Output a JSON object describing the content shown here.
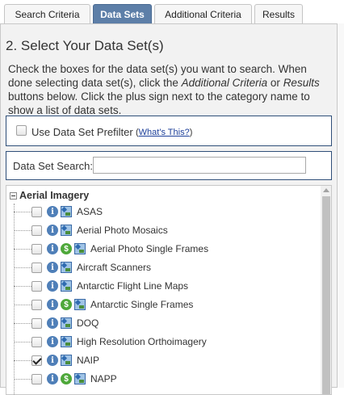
{
  "tabs": [
    {
      "label": "Search Criteria",
      "active": false
    },
    {
      "label": "Data Sets",
      "active": true
    },
    {
      "label": "Additional Criteria",
      "active": false
    },
    {
      "label": "Results",
      "active": false
    }
  ],
  "section": {
    "title": "2. Select Your Data Set(s)",
    "intro_1": "Check the boxes for the data set(s) you want to search. When done selecting data set(s), click the ",
    "intro_em1": "Additional Criteria",
    "intro_2": " or ",
    "intro_em2": "Results",
    "intro_3": " buttons below. Click the plus sign next to the category name to show a list of data sets."
  },
  "prefilter": {
    "label": "Use Data Set Prefilter",
    "link_open": "(",
    "link_text": "What's This?",
    "link_close": ")",
    "checked": false
  },
  "search": {
    "label": "Data Set Search:",
    "value": ""
  },
  "tree": {
    "category": "Aerial Imagery",
    "expanded": true,
    "items": [
      {
        "label": "ASAS",
        "checked": false,
        "has_dollar": false,
        "icons": [
          "info-icon",
          "map-icon"
        ]
      },
      {
        "label": "Aerial Photo Mosaics",
        "checked": false,
        "has_dollar": false,
        "icons": [
          "info-icon",
          "map-icon"
        ]
      },
      {
        "label": "Aerial Photo Single Frames",
        "checked": false,
        "has_dollar": true,
        "icons": [
          "info-icon",
          "dollar-icon",
          "map-icon"
        ]
      },
      {
        "label": "Aircraft Scanners",
        "checked": false,
        "has_dollar": false,
        "icons": [
          "info-icon",
          "map-icon"
        ]
      },
      {
        "label": "Antarctic Flight Line Maps",
        "checked": false,
        "has_dollar": false,
        "icons": [
          "info-icon",
          "map-icon"
        ]
      },
      {
        "label": "Antarctic Single Frames",
        "checked": false,
        "has_dollar": true,
        "icons": [
          "info-icon",
          "dollar-icon",
          "map-icon"
        ]
      },
      {
        "label": "DOQ",
        "checked": false,
        "has_dollar": false,
        "icons": [
          "info-icon",
          "map-icon"
        ]
      },
      {
        "label": "High Resolution Orthoimagery",
        "checked": false,
        "has_dollar": false,
        "icons": [
          "info-icon",
          "map-icon"
        ]
      },
      {
        "label": "NAIP",
        "checked": true,
        "has_dollar": false,
        "icons": [
          "info-icon",
          "map-icon"
        ]
      },
      {
        "label": "NAPP",
        "checked": false,
        "has_dollar": true,
        "icons": [
          "info-icon",
          "dollar-icon",
          "map-icon"
        ]
      }
    ]
  },
  "icon_glyphs": {
    "info": "i",
    "dollar": "$"
  },
  "colors": {
    "active_tab": "#5d7fa8",
    "info_icon": "#4f7fb8",
    "dollar_icon": "#4ea83a",
    "box_border": "#2f4f79",
    "link": "#1d3f9a"
  }
}
